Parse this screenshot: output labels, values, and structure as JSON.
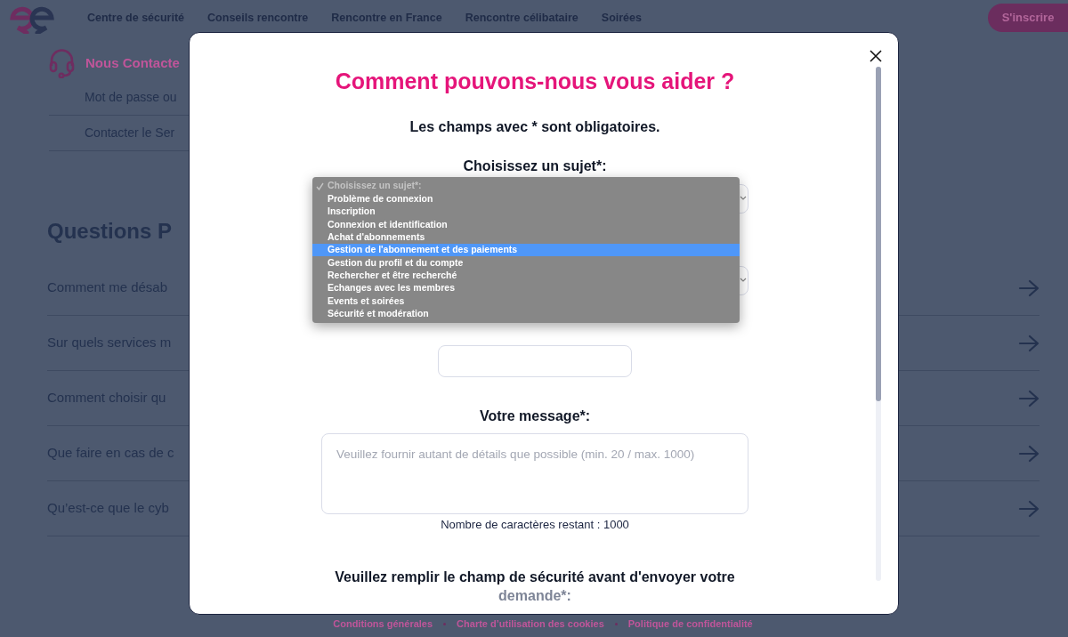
{
  "header": {
    "nav": [
      "Centre de sécurité",
      "Conseils rencontre",
      "Rencontre en France",
      "Rencontre célibataire",
      "Soirées"
    ],
    "signup_button": "S'inscrire"
  },
  "contact": {
    "title": "Nous Contacte",
    "links": [
      "Mot de passe ou",
      "Contacter le Ser"
    ]
  },
  "faq": {
    "title": "Questions P",
    "items": [
      "Comment me désab",
      "Sur quels services m",
      "Comment choisir qu",
      "Que faire en cas de c",
      "Qu’est-ce que le cyb"
    ]
  },
  "footer_links": [
    "Conditions générales",
    "Charte d’utilisation des cookies",
    "Politique de confidentialité"
  ],
  "modal": {
    "title": "Comment pouvons-nous vous aider ?",
    "required_note": "Les champs avec * sont obligatoires.",
    "subject_label": "Choisissez un sujet*:",
    "subject_options": [
      {
        "label": "Choisissez un sujet*:",
        "checked": true,
        "disabled": true,
        "selected": false
      },
      {
        "label": "Problème de connexion",
        "checked": false,
        "disabled": false,
        "selected": false
      },
      {
        "label": "Inscription",
        "checked": false,
        "disabled": false,
        "selected": false
      },
      {
        "label": "Connexion et identification",
        "checked": false,
        "disabled": false,
        "selected": false
      },
      {
        "label": "Achat d'abonnements",
        "checked": false,
        "disabled": false,
        "selected": false
      },
      {
        "label": "Gestion de l'abonnement et des paiements",
        "checked": false,
        "disabled": false,
        "selected": true
      },
      {
        "label": "Gestion du profil et du compte",
        "checked": false,
        "disabled": false,
        "selected": false
      },
      {
        "label": "Rechercher et être recherché",
        "checked": false,
        "disabled": false,
        "selected": false
      },
      {
        "label": "Echanges avec les membres",
        "checked": false,
        "disabled": false,
        "selected": false
      },
      {
        "label": "Events et soirées",
        "checked": false,
        "disabled": false,
        "selected": false
      },
      {
        "label": "Sécurité et modération",
        "checked": false,
        "disabled": false,
        "selected": false
      }
    ],
    "message_label": "Votre message*:",
    "message_placeholder": "Veuillez fournir autant de détails que possible (min. 20 / max. 1000)",
    "char_count": "Nombre de caractères restant : 1000",
    "security_label": "Veuillez remplir le champ de sécurité avant d'envoyer votre",
    "security_label_end": "demande*:"
  }
}
